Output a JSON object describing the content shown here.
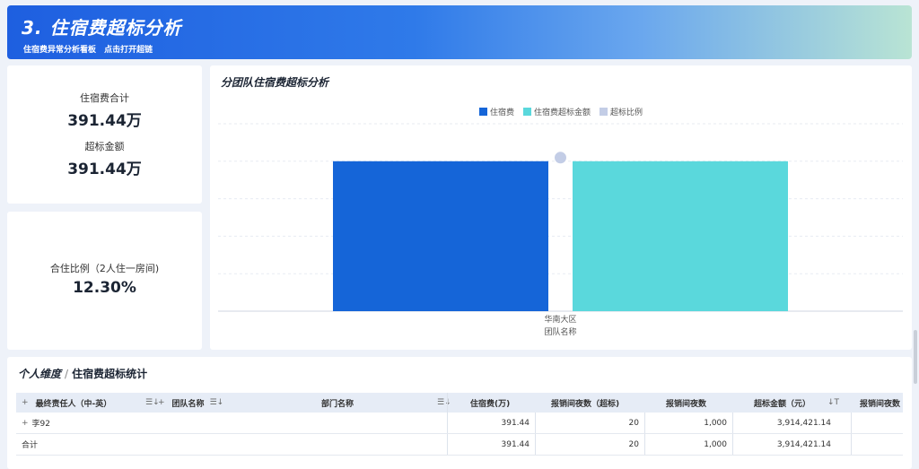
{
  "banner": {
    "title": "3. 住宿费超标分析",
    "subtitle": "住宿费异常分析看板",
    "link": "点击打开超链"
  },
  "kpi1": {
    "label_total": "住宿费合计",
    "value_total": "391.44万",
    "label_over": "超标金额",
    "value_over": "391.44万"
  },
  "kpi2": {
    "label": "合住比例（2人住一房间)",
    "value": "12.30%"
  },
  "chart": {
    "title": "分团队住宿费超标分析",
    "legend": [
      "住宿费",
      "住宿费超标金额",
      "超标比例"
    ],
    "colors": [
      "#1565d8",
      "#5ad8dc",
      "#c3cde6"
    ],
    "xlabel": "团队名称"
  },
  "chart_data": {
    "type": "bar",
    "categories": [
      "华南大区"
    ],
    "series": [
      {
        "name": "住宿费",
        "values": [
          391.44
        ]
      },
      {
        "name": "住宿费超标金额",
        "values": [
          391.44
        ]
      },
      {
        "name": "超标比例",
        "values": [
          1
        ]
      }
    ],
    "xlabel": "团队名称",
    "ylabel": "",
    "grid": true,
    "legend_position": "top-center"
  },
  "table": {
    "title": "个人维度",
    "subtitle": "住宿费超标统计",
    "headers": [
      "最终责任人（中-英）",
      "团队名称",
      "部门名称",
      "住宿费(万)",
      "报销间夜数（超标)",
      "报销间夜数",
      "超标金额（元）",
      "报销间夜数"
    ],
    "rows": [
      {
        "name": "李92",
        "team": "",
        "dept": "",
        "fee": "391.44",
        "nights_over": "20",
        "nights": "1,000",
        "over_amount": "3,914,421.14",
        "nights2": ""
      }
    ],
    "total": {
      "label": "合计",
      "fee": "391.44",
      "nights_over": "20",
      "nights": "1,000",
      "over_amount": "3,914,421.14"
    }
  }
}
